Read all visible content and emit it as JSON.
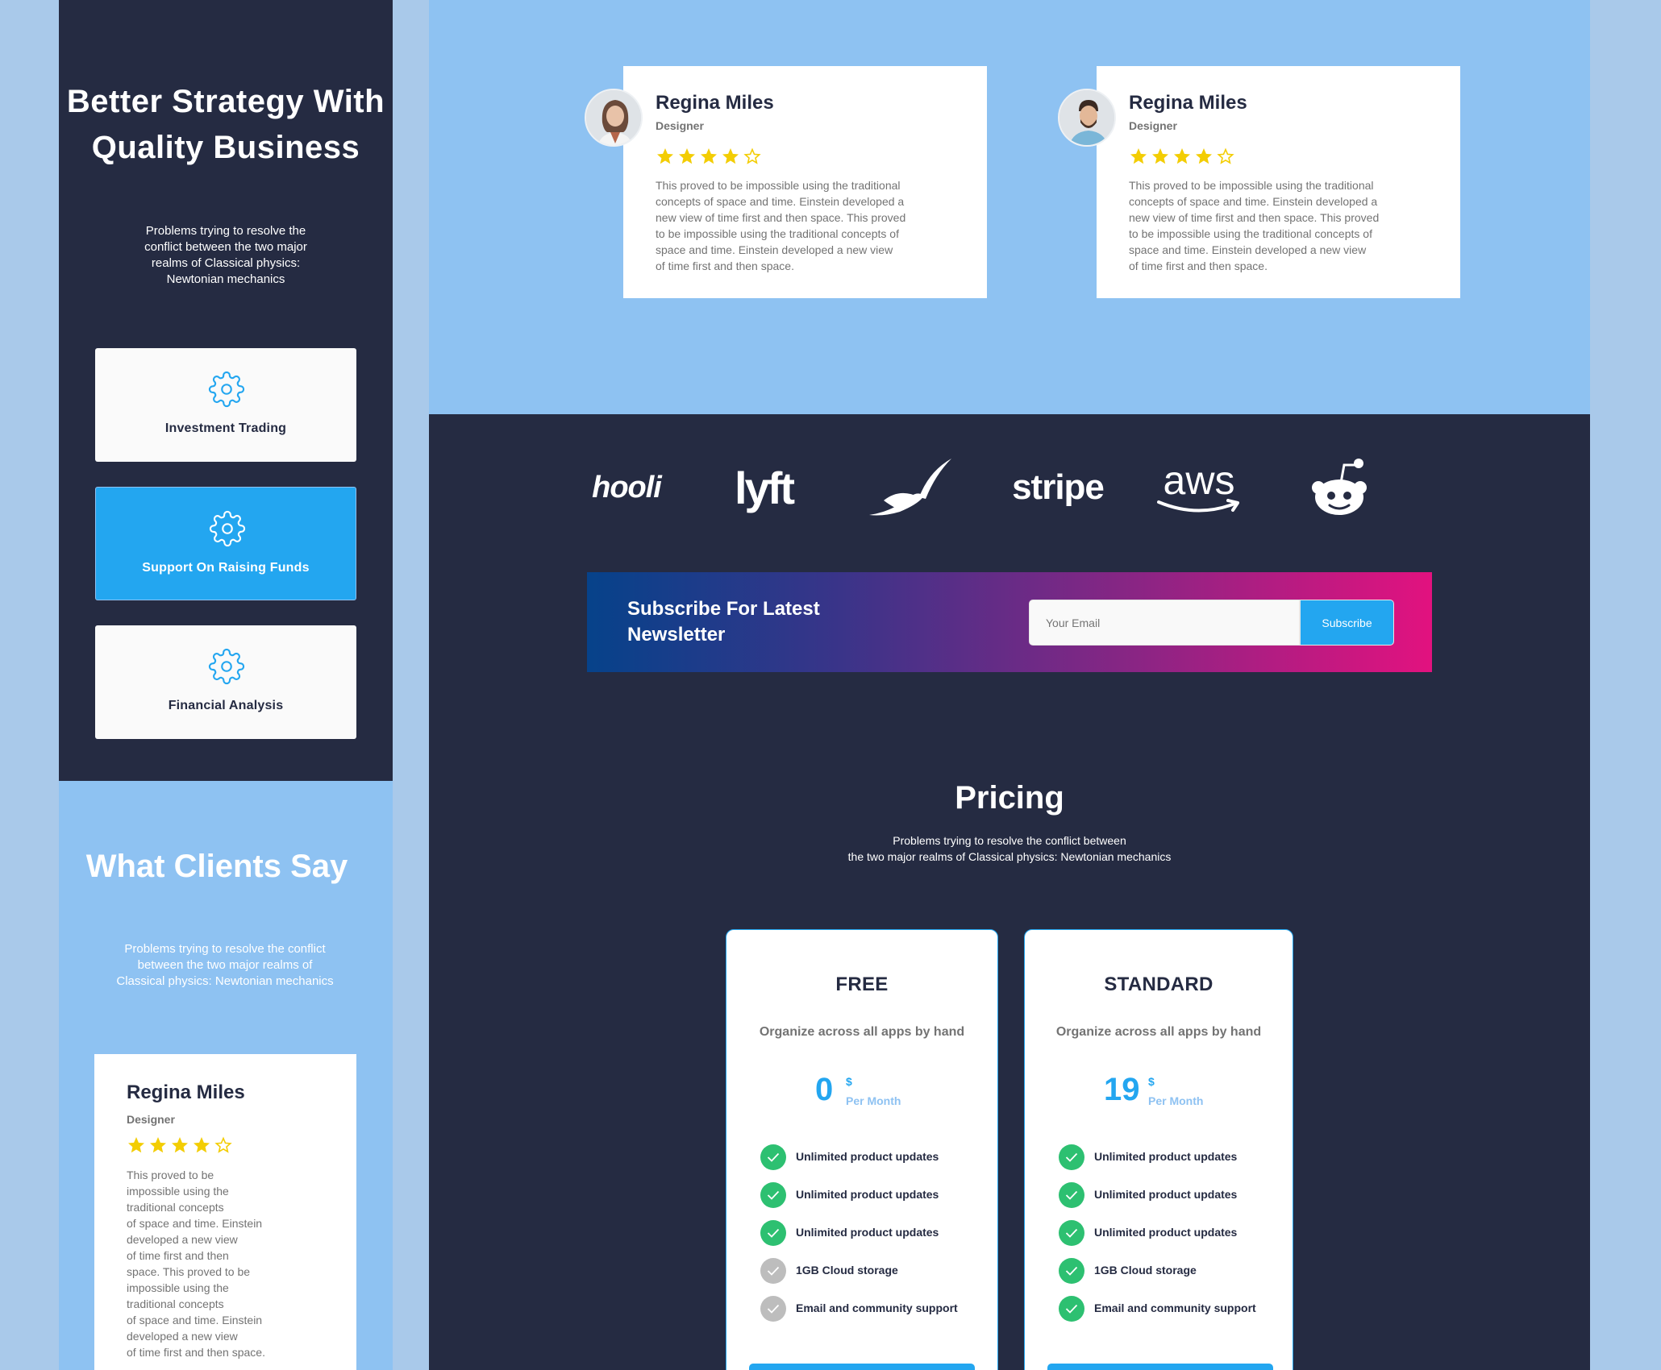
{
  "mobile": {
    "hero": {
      "title": "Better Strategy With Quality Business",
      "subtitle": "Problems trying to resolve the conflict between the two major realms of Classical physics: Newtonian mechanics"
    },
    "features": [
      {
        "label": "Investment Trading",
        "icon": "gear-icon",
        "active": false
      },
      {
        "label": "Support On Raising Funds",
        "icon": "gear-icon",
        "active": true
      },
      {
        "label": "Financial Analysis",
        "icon": "gear-icon",
        "active": false
      }
    ],
    "clients": {
      "title": "What Clients Say",
      "subtitle": "Problems trying to resolve the conflict between the two major realms of Classical physics: Newtonian mechanics",
      "card": {
        "name": "Regina Miles",
        "role": "Designer",
        "rating": 4,
        "quote": "This proved to be\nimpossible using the\ntraditional concepts\nof space and time. Einstein\ndeveloped a new view\nof time first and then\nspace. This proved to be\nimpossible using the\ntraditional concepts\nof space and time. Einstein\ndeveloped a new view\nof time first and then space."
      }
    }
  },
  "testimonials": [
    {
      "name": "Regina Miles",
      "role": "Designer",
      "rating": 4,
      "avatar": "avatar-woman",
      "quote": "This proved to be impossible using the traditional\nconcepts of space and time. Einstein developed a\nnew view of time first and then space. This proved\nto be impossible using the traditional concepts of\nspace and time. Einstein developed a new view\nof time first and then space."
    },
    {
      "name": "Regina Miles",
      "role": "Designer",
      "rating": 4,
      "avatar": "avatar-man",
      "quote": "This proved to be impossible using the traditional\nconcepts of space and time. Einstein developed a\nnew view of time first and then space. This proved\nto be impossible using the traditional concepts of\nspace and time. Einstein developed a new view\nof time first and then space."
    }
  ],
  "logos": [
    {
      "name": "hooli",
      "text": "hooli"
    },
    {
      "name": "lyft",
      "text": "lyft"
    },
    {
      "name": "pied-piper",
      "text": ""
    },
    {
      "name": "stripe",
      "text": "stripe"
    },
    {
      "name": "aws",
      "text": "aws"
    },
    {
      "name": "reddit",
      "text": ""
    }
  ],
  "newsletter": {
    "title": "Subscribe For Latest Newsletter",
    "email_placeholder": "Your Email",
    "button_label": "Subscribe"
  },
  "pricing": {
    "title": "Pricing",
    "subtitle": "Problems trying to resolve the conflict between\nthe two major realms of Classical physics: Newtonian mechanics",
    "plans": [
      {
        "name": "FREE",
        "description": "Organize across all apps by hand",
        "price": "0",
        "currency": "$",
        "period": "Per Month",
        "features": [
          {
            "label": "Unlimited product updates",
            "included": true
          },
          {
            "label": "Unlimited product updates",
            "included": true
          },
          {
            "label": "Unlimited product updates",
            "included": true
          },
          {
            "label": "1GB  Cloud storage",
            "included": false
          },
          {
            "label": "Email and community support",
            "included": false
          }
        ]
      },
      {
        "name": "STANDARD",
        "description": "Organize across all apps by hand",
        "price": "19",
        "currency": "$",
        "period": "Per Month",
        "features": [
          {
            "label": "Unlimited product updates",
            "included": true
          },
          {
            "label": "Unlimited product updates",
            "included": true
          },
          {
            "label": "Unlimited product updates",
            "included": true
          },
          {
            "label": "1GB  Cloud storage",
            "included": true
          },
          {
            "label": "Email and community support",
            "included": true
          }
        ]
      }
    ]
  },
  "colors": {
    "dark": "#252b42",
    "light_blue": "#8ec2f2",
    "primary": "#23a6f0",
    "success": "#2dc071",
    "muted": "#bdbdbd",
    "star": "#f3cd03"
  }
}
